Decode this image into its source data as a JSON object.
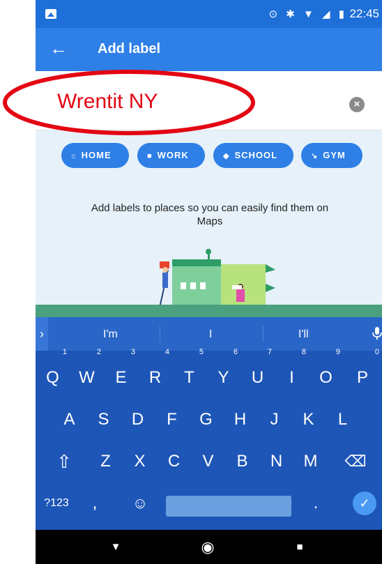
{
  "status": {
    "time": "22:45",
    "icons": "⊙ ✱ ▼ ◢ ▮"
  },
  "appbar": {
    "title": "Add label",
    "back_icon": "arrow-left-icon"
  },
  "input": {
    "value": "Wrentit NY",
    "clear_icon": "×"
  },
  "chips": [
    {
      "icon": "⌂",
      "label": "HOME"
    },
    {
      "icon": "■",
      "label": "WORK"
    },
    {
      "icon": "◆",
      "label": "SCHOOL"
    },
    {
      "icon": "↘",
      "label": "GYM"
    }
  ],
  "hint": "Add labels to places so you can easily find them on Maps",
  "keyboard": {
    "suggestions": [
      "I'm",
      "I",
      "I'll"
    ],
    "expand": "›",
    "row1": [
      {
        "k": "Q",
        "n": "1"
      },
      {
        "k": "W",
        "n": "2"
      },
      {
        "k": "E",
        "n": "3"
      },
      {
        "k": "R",
        "n": "4"
      },
      {
        "k": "T",
        "n": "5"
      },
      {
        "k": "Y",
        "n": "6"
      },
      {
        "k": "U",
        "n": "7"
      },
      {
        "k": "I",
        "n": "8"
      },
      {
        "k": "O",
        "n": "9"
      },
      {
        "k": "P",
        "n": "0"
      }
    ],
    "row2": [
      "A",
      "S",
      "D",
      "F",
      "G",
      "H",
      "J",
      "K",
      "L"
    ],
    "row3": [
      "Z",
      "X",
      "C",
      "V",
      "B",
      "N",
      "M"
    ],
    "shift": "⇧",
    "backspace": "⌫",
    "symbols": "?123",
    "comma": ",",
    "emoji": "☺",
    "period": ".",
    "enter": "✓"
  },
  "nav": {
    "back": "▼",
    "home": "◉",
    "recents": "■"
  },
  "colors": {
    "appbar": "#2e7fe6",
    "keyboard": "#1e56b7",
    "annotation": "#e30613"
  }
}
